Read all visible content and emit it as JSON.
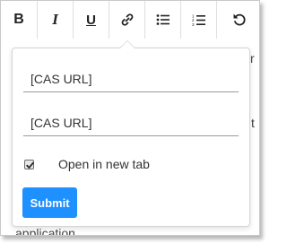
{
  "toolbar": {
    "bold_label": "B",
    "italic_label": "I",
    "underline_label": "U",
    "buttons": [
      "bold",
      "italic",
      "underline",
      "link-icon",
      "bullet-list-icon",
      "numbered-list-icon",
      "undo-icon"
    ]
  },
  "background_text": {
    "right_fragment_1": "r",
    "right_fragment_2": "t",
    "bottom_fragment": "application"
  },
  "link_popover": {
    "url_field_1_value": "[CAS URL]",
    "url_field_2_value": "[CAS URL]",
    "open_new_tab_label": "Open in new tab",
    "open_new_tab_checked": true,
    "submit_label": "Submit"
  },
  "colors": {
    "accent": "#1e90ff",
    "border": "#dedede"
  }
}
